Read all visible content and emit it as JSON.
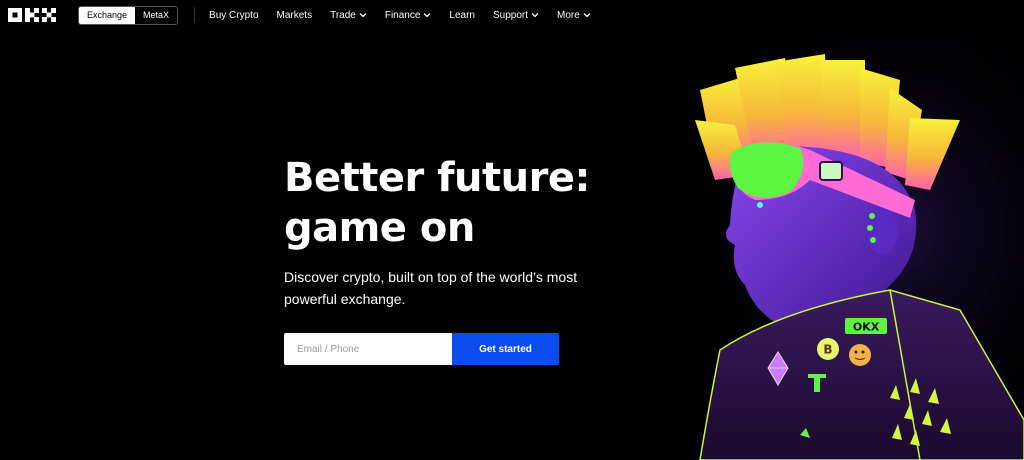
{
  "nav": {
    "logo_text": "OKX",
    "segment": {
      "exchange": "Exchange",
      "metax": "MetaX"
    },
    "items": [
      {
        "label": "Buy Crypto",
        "dropdown": false
      },
      {
        "label": "Markets",
        "dropdown": false
      },
      {
        "label": "Trade",
        "dropdown": true
      },
      {
        "label": "Finance",
        "dropdown": true
      },
      {
        "label": "Learn",
        "dropdown": false
      },
      {
        "label": "Support",
        "dropdown": true
      },
      {
        "label": "More",
        "dropdown": true
      }
    ]
  },
  "hero": {
    "title_line1": "Better future:",
    "title_line2": "game on",
    "subtitle": "Discover crypto, built on top of the world’s most powerful exchange.",
    "email_placeholder": "Email / Phone",
    "cta_label": "Get started"
  },
  "art": {
    "badge_text": "OKX",
    "icons": [
      "ethereum-pin-icon",
      "bitcoin-pin-icon",
      "doge-pin-icon",
      "tether-pin-icon"
    ]
  },
  "colors": {
    "background": "#000000",
    "cta": "#0a4cf0",
    "neon_green": "#5df542",
    "skin_purple": "#6a2fd6",
    "hair_yellow": "#f7f23a",
    "hair_pink": "#ff5fb0"
  }
}
